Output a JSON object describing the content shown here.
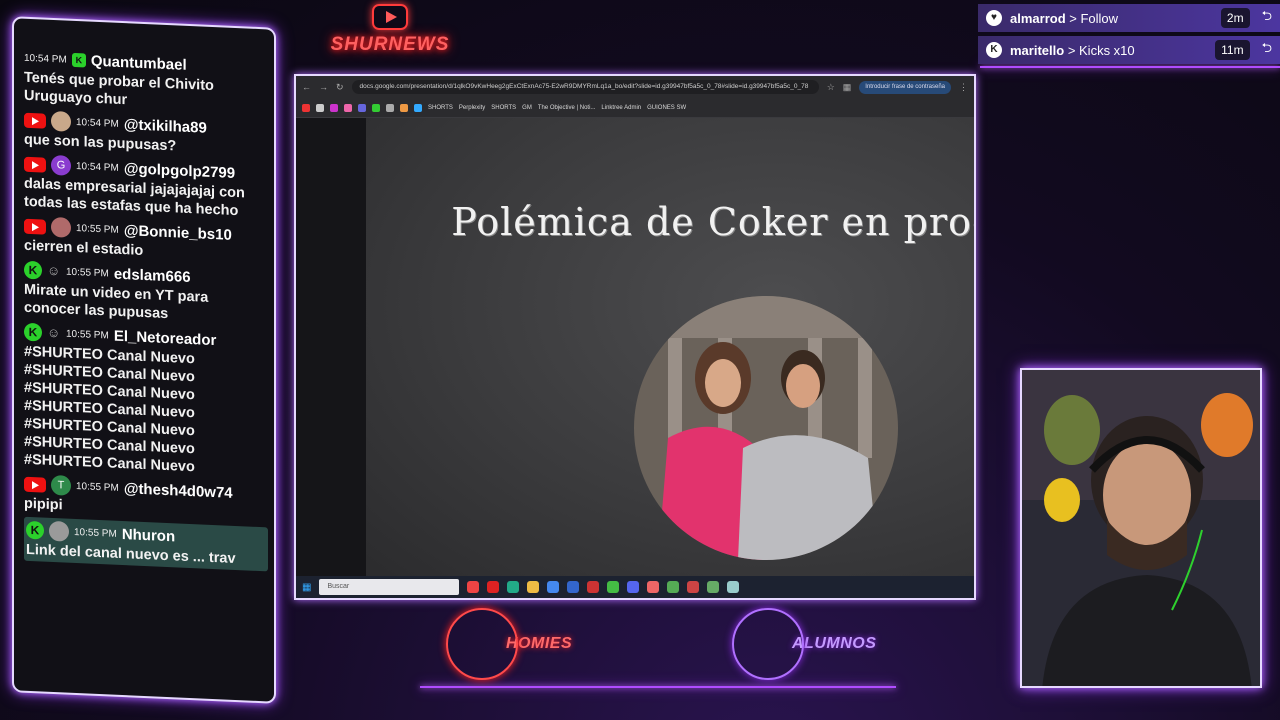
{
  "logo": {
    "name": "SHURNEWS"
  },
  "alerts": [
    {
      "user": "almarrod",
      "action": "> Follow",
      "ago": "2m",
      "icon": "heart-icon"
    },
    {
      "user": "maritello",
      "action": "> Kicks x10",
      "ago": "11m",
      "icon": "kick-icon"
    }
  ],
  "chat": {
    "messages": [
      {
        "platform": "kick",
        "time": "10:54 PM",
        "user": "Quantumbael",
        "text": "Tenés que probar el Chivito Uruguayo chur"
      },
      {
        "platform": "youtube",
        "time": "10:54 PM",
        "user": "@txikilha89",
        "text": "que son las pupusas?"
      },
      {
        "platform": "youtube",
        "time": "10:54 PM",
        "user": "@golpgolp2799",
        "avatar_letter": "G",
        "text": "dalas empresarial jajajajajaj con todas las estafas que ha hecho"
      },
      {
        "platform": "youtube",
        "time": "10:55 PM",
        "user": "@Bonnie_bs10",
        "text": "cierren el estadio"
      },
      {
        "platform": "kick",
        "time": "10:55 PM",
        "user": "edslam666",
        "text": "Mirate un video en YT para conocer las pupusas"
      },
      {
        "platform": "kick",
        "time": "10:55 PM",
        "user": "El_Netoreador",
        "text": "#SHURTEO Canal Nuevo\n#SHURTEO Canal Nuevo\n#SHURTEO Canal Nuevo\n#SHURTEO Canal Nuevo\n#SHURTEO Canal Nuevo\n#SHURTEO Canal Nuevo\n#SHURTEO Canal Nuevo"
      },
      {
        "platform": "youtube",
        "time": "10:55 PM",
        "user": "@thesh4d0w74",
        "avatar_letter": "T",
        "text": "pipipi"
      },
      {
        "platform": "kick",
        "time": "10:55 PM",
        "user": "Nhuron",
        "text": "Link del canal nuevo es ... trav"
      }
    ]
  },
  "browser": {
    "url": "docs.google.com/presentation/d/1qlkO9vKwHeeg2gExCtExnAc75-E2wR9DMYRmLq1a_bo/edit?slide=id.g39947bf5a5c_0_78#slide=id.g39947bf5a5c_0_78",
    "password_prompt": "Introducir frase de contraseña",
    "bookmarks": [
      "SHORTS",
      "Perplexity",
      "SHORTS",
      "GM",
      "The Objective | Noti...",
      "Linktree Admin",
      "GUIONES SW"
    ],
    "taskbar_search": "Buscar"
  },
  "slide": {
    "title": "Polémica de Coker en programa"
  },
  "bottom_logos": [
    {
      "label": "HOMIES",
      "color": "#ff4a4a"
    },
    {
      "label": "ALUMNOS",
      "color": "#b070ff"
    }
  ]
}
